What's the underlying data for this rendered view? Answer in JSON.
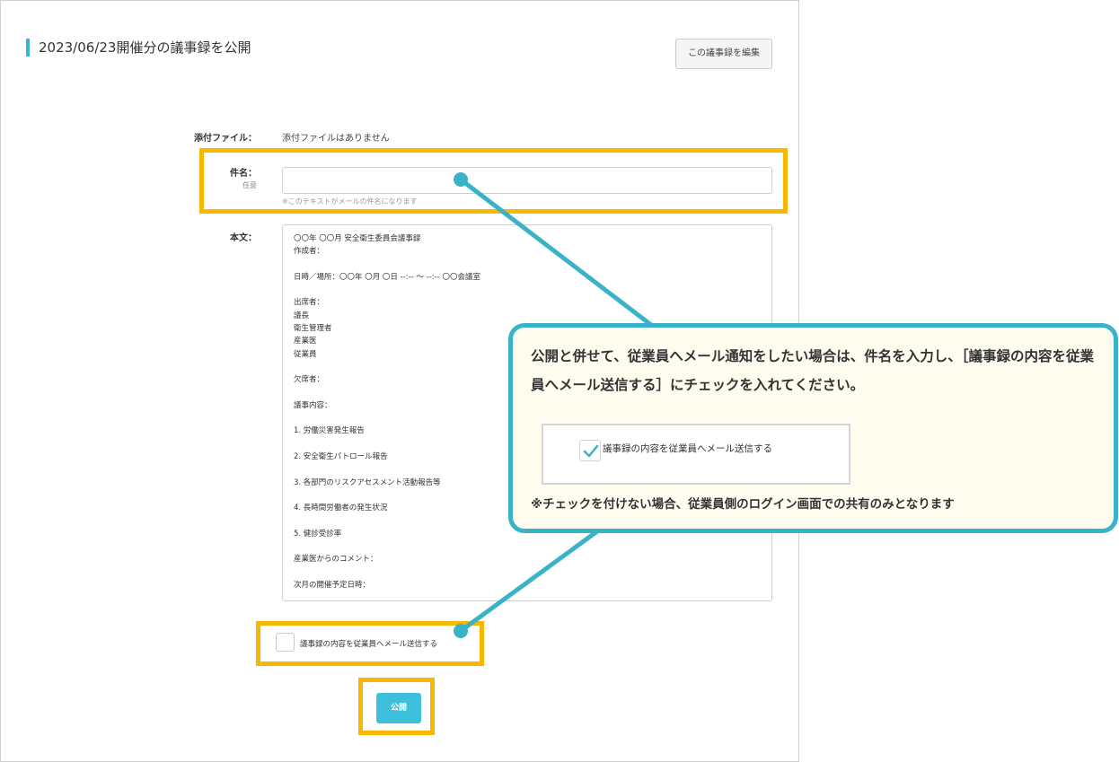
{
  "page": {
    "title": "2023/06/23開催分の議事録を公開",
    "edit_button_label": "この議事録を編集"
  },
  "form": {
    "attachment_label": "添付ファイル：",
    "attachment_value": "添付ファイルはありません",
    "subject_label": "件名：",
    "subject_optional": "任意",
    "subject_value": "",
    "subject_hint": "※このテキストがメールの件名になります",
    "body_label": "本文：",
    "body_lines": [
      "〇〇年 〇〇月 安全衛生委員会議事録",
      "作成者：",
      "",
      "日時／場所：〇〇年 〇月 〇日 --:-- ～ --:-- 〇〇会議室",
      "",
      "出席者：",
      "議長",
      "衛生管理者",
      "産業医",
      "従業員",
      "",
      "欠席者：",
      "",
      "議事内容：",
      "",
      "1. 労働災害発生報告",
      "",
      "2. 安全衛生パトロール報告",
      "",
      "3. 各部門のリスクアセスメント活動報告等",
      "",
      "4. 長時間労働者の発生状況",
      "",
      "5. 健診受診率",
      "",
      "産業医からのコメント：",
      "",
      "次月の開催予定日時："
    ],
    "notify_checkbox_label": "議事録の内容を従業員へメール送信する",
    "notify_checked": false,
    "publish_button_label": "公開"
  },
  "callout": {
    "text": "公開と併せて、従業員へメール通知をしたい場合は、件名を入力し、［議事録の内容を従業員へメール送信する］にチェックを入れてください。",
    "example_checkbox_label": "議事録の内容を従業員へメール送信する",
    "example_checked": true,
    "note": "※チェックを付けない場合、従業員側のログイン画面での共有のみとなります"
  },
  "colors": {
    "accent": "#3ec0dc",
    "highlight": "#f9b800",
    "callout_border": "#3ab3c8",
    "callout_bg": "#fefcef"
  }
}
